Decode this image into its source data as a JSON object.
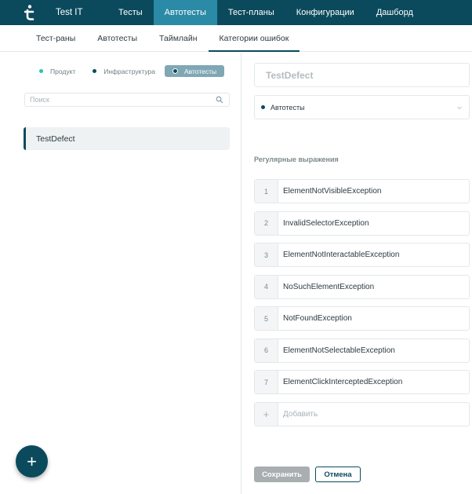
{
  "app": {
    "name": "Test IT"
  },
  "nav": {
    "items": [
      {
        "label": "Тесты"
      },
      {
        "label": "Автотесты"
      },
      {
        "label": "Тест-планы"
      },
      {
        "label": "Конфигурации"
      },
      {
        "label": "Дашборд"
      }
    ],
    "active_index": 1
  },
  "subtabs": {
    "items": [
      {
        "label": "Тест-раны"
      },
      {
        "label": "Автотесты"
      },
      {
        "label": "Таймлайн"
      },
      {
        "label": "Категории ошибок"
      }
    ],
    "active_index": 3
  },
  "filters": [
    {
      "label": "Продукт",
      "color": "#2ec4a4"
    },
    {
      "label": "Инфраструктура",
      "color": "#0b4a5c"
    },
    {
      "label": "Автотесты",
      "color": "#0b4a5c",
      "selected": true
    }
  ],
  "search": {
    "placeholder": "Поиск",
    "icon": "search-icon"
  },
  "categories": [
    {
      "label": "TestDefect",
      "selected": true
    }
  ],
  "fab": {
    "label": "+"
  },
  "editor": {
    "name_value": "TestDefect",
    "type_value": "Автотесты",
    "regex_label": "Регулярные выражения",
    "regexes": [
      {
        "num": "1",
        "text": "ElementNotVisibleException"
      },
      {
        "num": "2",
        "text": "InvalidSelectorException"
      },
      {
        "num": "3",
        "text": "ElementNotInteractableException"
      },
      {
        "num": "4",
        "text": "NoSuchElementException"
      },
      {
        "num": "5",
        "text": "NotFoundException"
      },
      {
        "num": "6",
        "text": "ElementNotSelectableException"
      },
      {
        "num": "7",
        "text": "ElementClickInterceptedException"
      }
    ],
    "add_symbol": "+",
    "add_placeholder": "Добавить",
    "save_label": "Сохранить",
    "cancel_label": "Отмена"
  },
  "colors": {
    "brand": "#0b4a5c",
    "nav_active": "#2b8aa6",
    "product_dot": "#2ec4a4"
  }
}
